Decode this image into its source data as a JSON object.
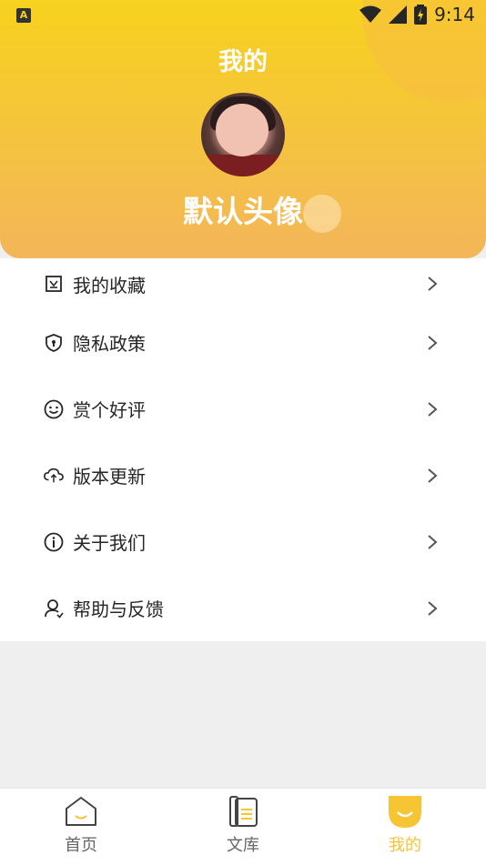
{
  "status_bar": {
    "app_icon": "A",
    "time": "9:14"
  },
  "header": {
    "title": "我的",
    "username": "默认头像"
  },
  "menu": [
    {
      "icon": "bookmark-icon",
      "label": "我的收藏"
    },
    {
      "icon": "shield-icon",
      "label": "隐私政策"
    },
    {
      "icon": "smile-icon",
      "label": "赏个好评"
    },
    {
      "icon": "cloud-sync-icon",
      "label": "版本更新"
    },
    {
      "icon": "info-icon",
      "label": "关于我们"
    },
    {
      "icon": "user-help-icon",
      "label": "帮助与反馈"
    }
  ],
  "tabbar": [
    {
      "label": "首页",
      "icon": "home-icon"
    },
    {
      "label": "文库",
      "icon": "library-icon"
    },
    {
      "label": "我的",
      "icon": "profile-icon",
      "active": true
    }
  ],
  "colors": {
    "accent": "#f7c434",
    "header_top": "#f7d21e",
    "header_bottom": "#f3b65a"
  }
}
